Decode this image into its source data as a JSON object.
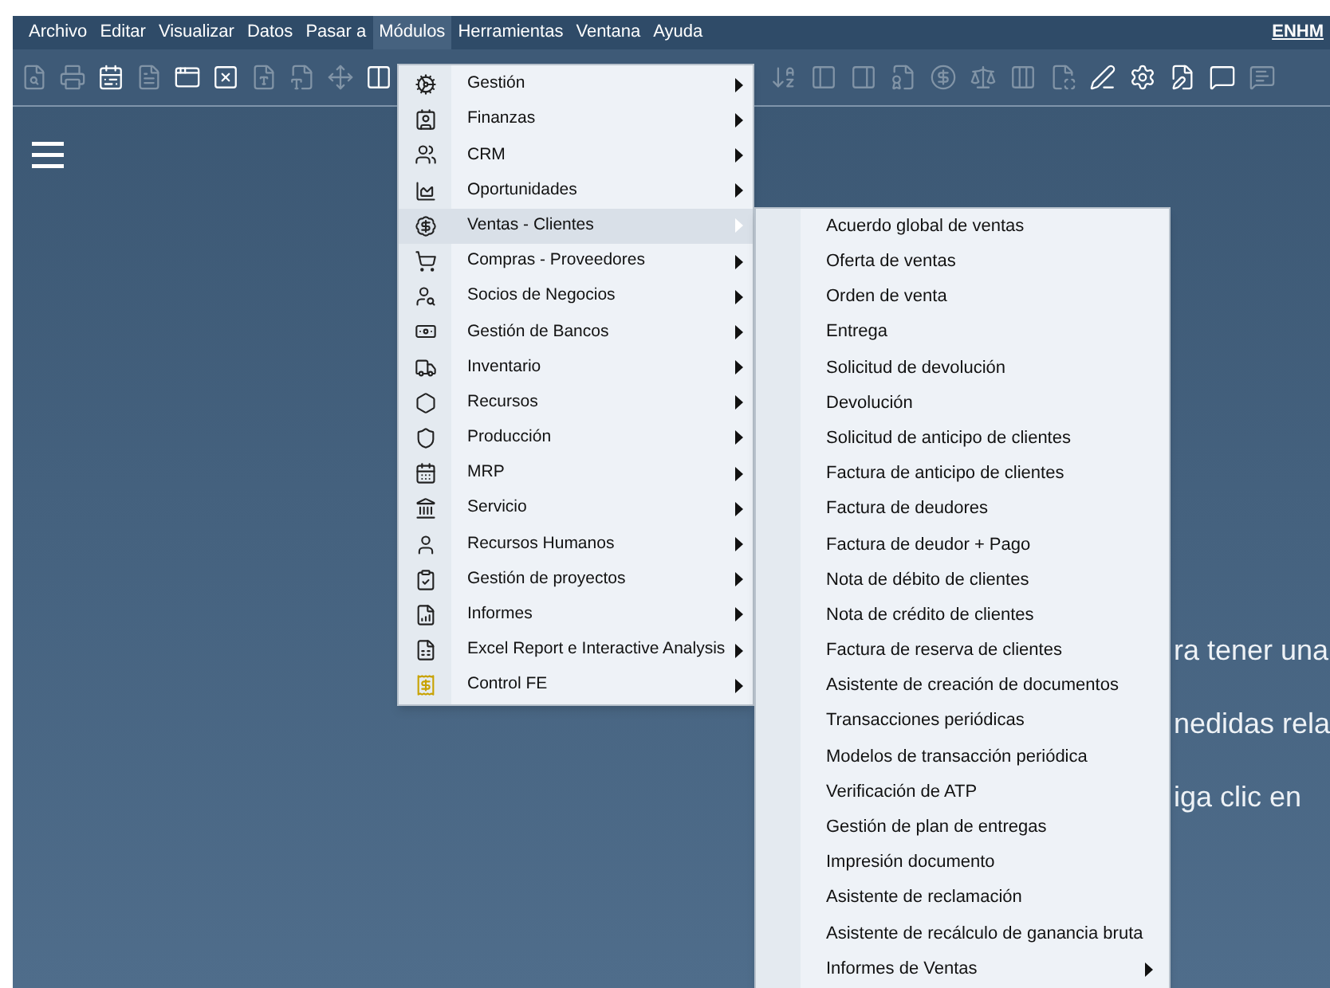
{
  "menubar": [
    {
      "label": "Archivo",
      "selected": false
    },
    {
      "label": "Editar",
      "selected": false
    },
    {
      "label": "Visualizar",
      "selected": false
    },
    {
      "label": "Datos",
      "selected": false
    },
    {
      "label": "Pasar a",
      "selected": false
    },
    {
      "label": "Módulos",
      "selected": true
    },
    {
      "label": "Herramientas",
      "selected": false
    },
    {
      "label": "Ventana",
      "selected": false
    },
    {
      "label": "Ayuda",
      "selected": false
    }
  ],
  "user": "ENHM",
  "toolbar_left": [
    {
      "disabled": true
    },
    {
      "disabled": true
    },
    {
      "disabled": false
    },
    {
      "disabled": true
    },
    {
      "disabled": false
    },
    {
      "disabled": false
    },
    {
      "disabled": true
    },
    {
      "disabled": true
    },
    {
      "disabled": true
    },
    {
      "disabled": false
    }
  ],
  "toolbar_right": [
    {
      "disabled": true
    },
    {
      "disabled": true
    },
    {
      "disabled": true
    },
    {
      "disabled": true
    },
    {
      "disabled": true
    },
    {
      "disabled": true
    },
    {
      "disabled": true
    },
    {
      "disabled": true
    },
    {
      "disabled": false
    },
    {
      "disabled": false
    },
    {
      "disabled": false
    },
    {
      "disabled": false
    },
    {
      "disabled": true
    }
  ],
  "background_text": [
    "ra tener una",
    "nedidas rela",
    "iga clic en"
  ],
  "modules_menu": [
    {
      "label": "Gestión",
      "selected": false
    },
    {
      "label": "Finanzas",
      "selected": false
    },
    {
      "label": "CRM",
      "selected": false
    },
    {
      "label": "Oportunidades",
      "selected": false
    },
    {
      "label": "Ventas - Clientes",
      "selected": true
    },
    {
      "label": "Compras - Proveedores",
      "selected": false
    },
    {
      "label": "Socios de Negocios",
      "selected": false
    },
    {
      "label": "Gestión de Bancos",
      "selected": false
    },
    {
      "label": "Inventario",
      "selected": false
    },
    {
      "label": "Recursos",
      "selected": false
    },
    {
      "label": "Producción",
      "selected": false
    },
    {
      "label": "MRP",
      "selected": false
    },
    {
      "label": "Servicio",
      "selected": false
    },
    {
      "label": "Recursos Humanos",
      "selected": false
    },
    {
      "label": "Gestión de proyectos",
      "selected": false
    },
    {
      "label": "Informes",
      "selected": false
    },
    {
      "label": "Excel Report e Interactive Analysis",
      "selected": false
    },
    {
      "label": "Control FE",
      "selected": false
    }
  ],
  "sales_submenu": [
    {
      "label": "Acuerdo global de ventas",
      "submenu": false
    },
    {
      "label": "Oferta de ventas",
      "submenu": false
    },
    {
      "label": "Orden de venta",
      "submenu": false
    },
    {
      "label": "Entrega",
      "submenu": false
    },
    {
      "label": "Solicitud de devolución",
      "submenu": false
    },
    {
      "label": "Devolución",
      "submenu": false
    },
    {
      "label": "Solicitud de anticipo de clientes",
      "submenu": false
    },
    {
      "label": "Factura de anticipo de clientes",
      "submenu": false
    },
    {
      "label": "Factura de deudores",
      "submenu": false
    },
    {
      "label": "Factura de deudor + Pago",
      "submenu": false
    },
    {
      "label": "Nota de débito de clientes",
      "submenu": false
    },
    {
      "label": "Nota de crédito de clientes",
      "submenu": false
    },
    {
      "label": "Factura de reserva de clientes",
      "submenu": false
    },
    {
      "label": "Asistente de creación de documentos",
      "submenu": false
    },
    {
      "label": "Transacciones periódicas",
      "submenu": false
    },
    {
      "label": "Modelos de transacción periódica",
      "submenu": false
    },
    {
      "label": "Verificación de ATP",
      "submenu": false
    },
    {
      "label": "Gestión de plan de entregas",
      "submenu": false
    },
    {
      "label": "Impresión documento",
      "submenu": false
    },
    {
      "label": "Asistente de reclamación",
      "submenu": false
    },
    {
      "label": "Asistente de recálculo de ganancia bruta",
      "submenu": false
    },
    {
      "label": "Informes de Ventas",
      "submenu": true
    }
  ]
}
